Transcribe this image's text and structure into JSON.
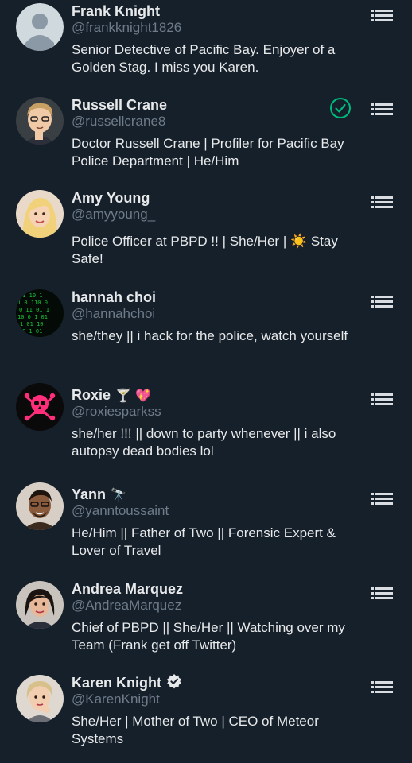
{
  "users": [
    {
      "name": "Frank Knight",
      "handle": "@frankknight1826",
      "bio": "Senior Detective of Pacific Bay. Enjoyer of a Golden Stag. I miss you Karen.",
      "avatar": "default-avatar"
    },
    {
      "name": "Russell Crane",
      "handle": "@russellcrane8",
      "bio": "Doctor Russell Crane | Profiler for Pacific Bay Police Department | He/Him",
      "avatar": "cartoon-avatar-russell",
      "followed": true
    },
    {
      "name": "Amy Young",
      "handle": "@amyyoung_",
      "bio": "Police Officer at PBPD !! | She/Her | ☀️ Stay Safe!",
      "avatar": "cartoon-avatar-amy"
    },
    {
      "name": "hannah choi",
      "handle": "@hannahchoi",
      "bio": "she/they || i hack for the police, watch yourself",
      "avatar": "matrix-code-avatar"
    },
    {
      "name": "Roxie",
      "name_emoji": "🍸 💖",
      "handle": "@roxiesparkss",
      "bio": "she/her !!! || down to party whenever || i also autopsy dead bodies lol",
      "avatar": "pink-skull-avatar"
    },
    {
      "name": "Yann",
      "name_emoji": "🔭",
      "handle": "@yanntoussaint",
      "bio": "He/Him || Father of Two || Forensic Expert & Lover of Travel",
      "avatar": "cartoon-avatar-yann"
    },
    {
      "name": "Andrea Marquez",
      "handle": "@AndreaMarquez",
      "bio": "Chief of PBPD || She/Her || Watching over my Team (Frank get off Twitter)",
      "avatar": "cartoon-avatar-andrea"
    },
    {
      "name": "Karen Knight",
      "handle": "@KarenKnight",
      "bio": "She/Her | Mother of Two | CEO of Meteor Systems",
      "avatar": "cartoon-avatar-karen",
      "verified": true
    }
  ],
  "icons": {
    "menu": "list-menu-icon",
    "followed": "check-circle-icon",
    "verified": "verified-badge-icon"
  },
  "colors": {
    "background": "#16202b",
    "text": "#e7e9ea",
    "secondary": "#6e7c8a",
    "accent_green": "#00ba7c",
    "roxie_pink": "#ff2d7a"
  }
}
